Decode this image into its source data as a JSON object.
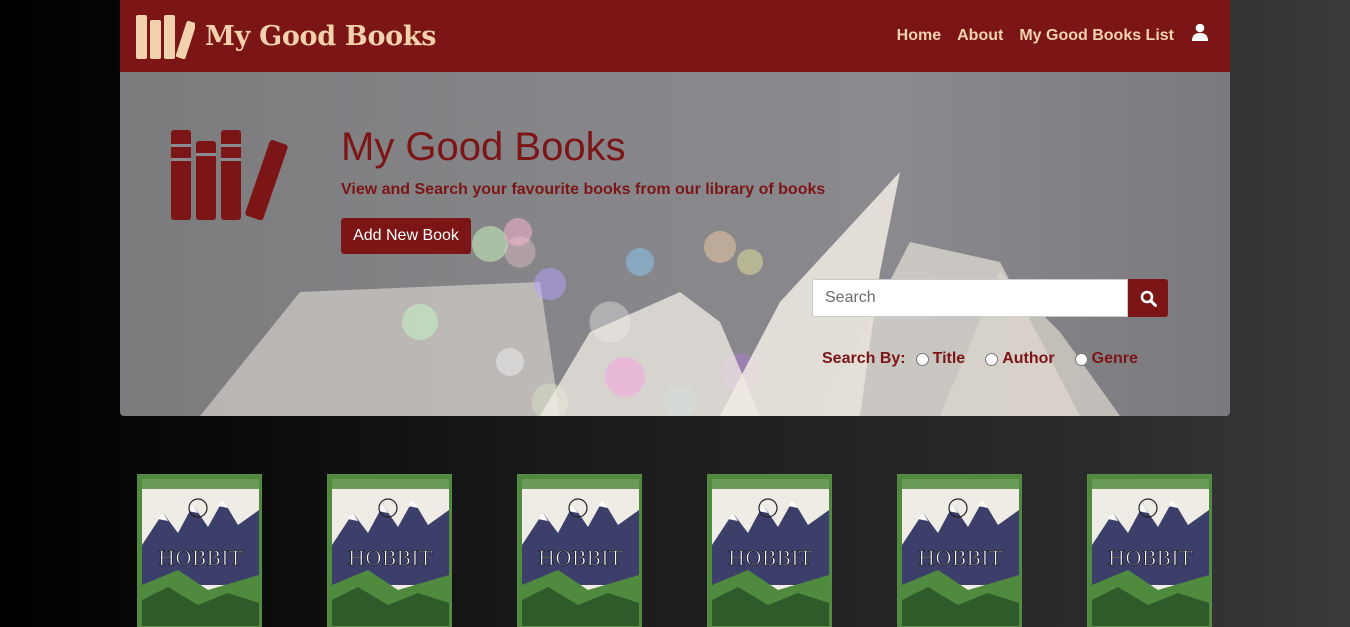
{
  "navbar": {
    "brand": "My Good Books",
    "links": [
      "Home",
      "About",
      "My Good Books List"
    ],
    "user_icon": "user-icon"
  },
  "hero": {
    "title": "My Good Books",
    "subtitle": "View and Search your favourite books from our library of books",
    "add_button": "Add New Book",
    "search_placeholder": "Search",
    "search_by_label": "Search By:",
    "search_options": [
      "Title",
      "Author",
      "Genre"
    ]
  },
  "books": [
    {
      "cover": "hobbit-cover",
      "title": "HOBBIT"
    },
    {
      "cover": "hobbit-cover",
      "title": "HOBBIT"
    },
    {
      "cover": "hobbit-cover",
      "title": "HOBBIT"
    },
    {
      "cover": "hobbit-cover",
      "title": "HOBBIT"
    },
    {
      "cover": "hobbit-cover",
      "title": "HOBBIT"
    },
    {
      "cover": "hobbit-cover",
      "title": "HOBBIT"
    }
  ],
  "colors": {
    "brand": "#7c1515",
    "brand_text": "#f2d2ad",
    "cover_green": "#4f8a3e",
    "cover_mountain": "#3d3f6b"
  }
}
